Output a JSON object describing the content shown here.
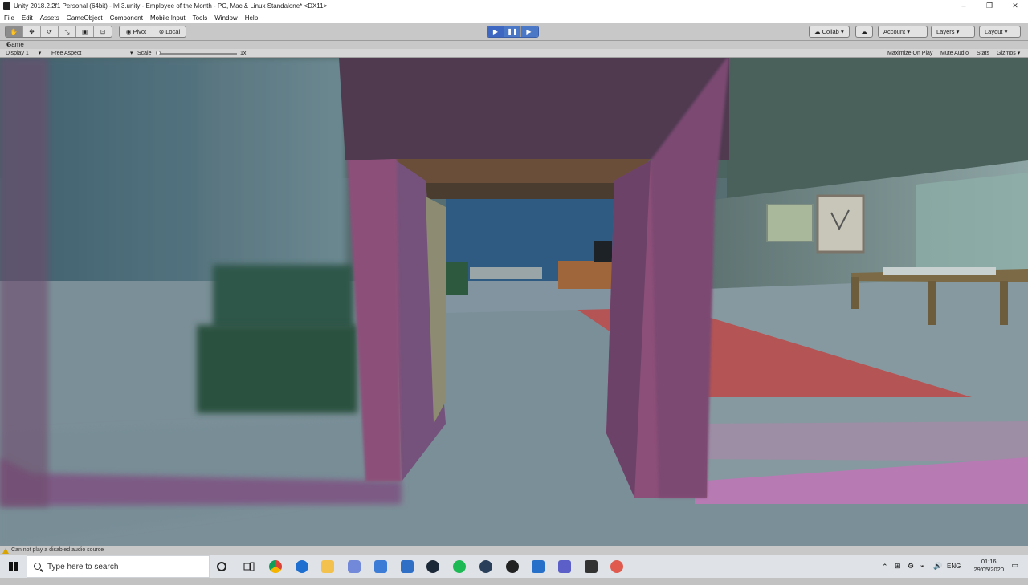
{
  "window": {
    "title": "Unity 2018.2.2f1 Personal (64bit) - lvl 3.unity - Employee of the Month - PC, Mac & Linux Standalone* <DX11>",
    "minimize": "–",
    "restore": "❐",
    "close": "✕"
  },
  "menu": [
    "File",
    "Edit",
    "Assets",
    "GameObject",
    "Component",
    "Mobile Input",
    "Tools",
    "Window",
    "Help"
  ],
  "toolbar": {
    "pivot_label": "Pivot",
    "local_label": "Local",
    "collab_label": "Collab ▾",
    "account_label": "Account",
    "layers_label": "Layers",
    "layout_label": "Layout"
  },
  "game_tab": {
    "label": "Game",
    "display": "Display 1",
    "aspect": "Free Aspect",
    "scale_label": "Scale",
    "scale_value": "1x",
    "maximize_on_play": "Maximize On Play",
    "mute_audio": "Mute Audio",
    "stats": "Stats",
    "gizmos": "Gizmos"
  },
  "status": {
    "message": "Can not play a disabled audio source"
  },
  "taskbar": {
    "search_placeholder": "Type here to search",
    "language": "ENG",
    "time": "01:16",
    "date": "29/05/2020"
  },
  "colors": {
    "play_blue": "#4a78c6",
    "wall_pink": "#8c4f79",
    "carpet_red": "#b45454"
  }
}
